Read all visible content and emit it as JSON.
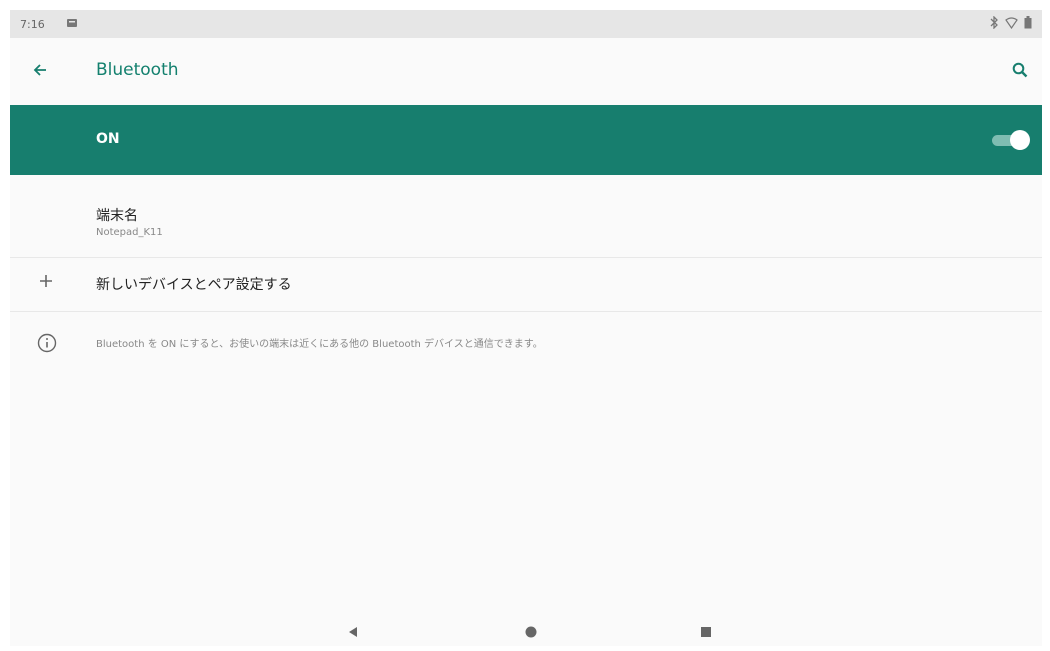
{
  "status_bar": {
    "time": "7:16",
    "icons": [
      "notification-icon",
      "bluetooth-icon",
      "wifi-icon",
      "battery-icon"
    ]
  },
  "app_bar": {
    "title": "Bluetooth",
    "back_icon": "arrow-back-icon",
    "search_icon": "search-icon"
  },
  "toggle": {
    "label": "ON",
    "state": true
  },
  "device_name": {
    "title": "端末名",
    "value": "Notepad_K11"
  },
  "pair": {
    "icon": "plus-icon",
    "label": "新しいデバイスとペア設定する"
  },
  "info": {
    "icon": "info-icon",
    "text": "Bluetooth を ON にすると、お使いの端末は近くにある他の Bluetooth デバイスと通信できます。"
  },
  "nav_bar": {
    "items": [
      "back-triangle-icon",
      "home-circle-icon",
      "recents-square-icon"
    ]
  },
  "colors": {
    "accent": "#177e6e",
    "title_text": "#13806e",
    "background": "#fafafa",
    "status_bar": "#e6e6e6"
  }
}
